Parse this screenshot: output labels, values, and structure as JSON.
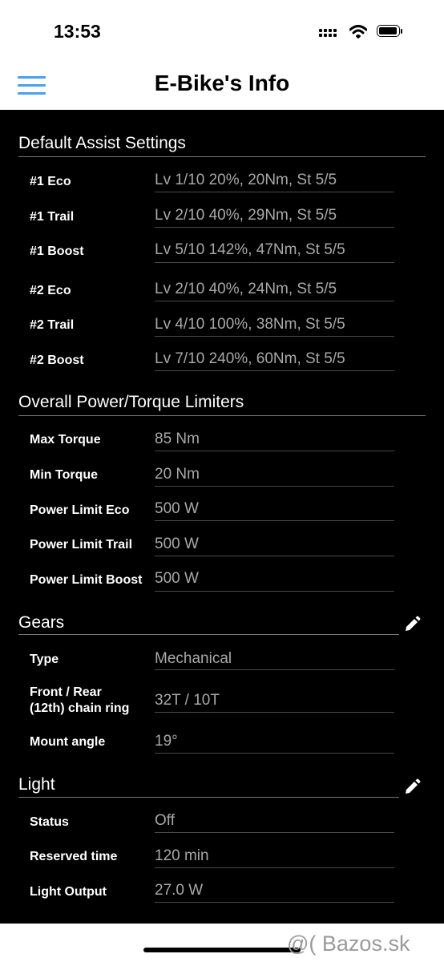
{
  "status_bar": {
    "time": "13:53"
  },
  "nav": {
    "title": "E-Bike's Info"
  },
  "sections": {
    "assist": {
      "title": "Default Assist Settings",
      "rows": [
        {
          "label": "#1 Eco",
          "value": "Lv 1/10 20%, 20Nm, St 5/5"
        },
        {
          "label": "#1 Trail",
          "value": "Lv 2/10 40%, 29Nm, St 5/5"
        },
        {
          "label": "#1 Boost",
          "value": "Lv 5/10 142%, 47Nm, St 5/5"
        },
        {
          "label": "#2 Eco",
          "value": "Lv 2/10 40%, 24Nm, St 5/5"
        },
        {
          "label": "#2 Trail",
          "value": "Lv 4/10 100%, 38Nm, St 5/5"
        },
        {
          "label": "#2 Boost",
          "value": "Lv 7/10 240%, 60Nm, St 5/5"
        }
      ]
    },
    "limiters": {
      "title": "Overall Power/Torque Limiters",
      "rows": [
        {
          "label": "Max Torque",
          "value": "85 Nm"
        },
        {
          "label": "Min Torque",
          "value": "20 Nm"
        },
        {
          "label": "Power Limit Eco",
          "value": "500 W"
        },
        {
          "label": "Power Limit Trail",
          "value": "500 W"
        },
        {
          "label": "Power Limit Boost",
          "value": "500 W"
        }
      ]
    },
    "gears": {
      "title": "Gears",
      "edit_icon": "pencil-icon",
      "rows": [
        {
          "label": "Type",
          "value": "Mechanical"
        },
        {
          "label": "Front / Rear",
          "label2": "(12th) chain ring",
          "value": "32T / 10T"
        },
        {
          "label": "Mount angle",
          "value": "19°"
        }
      ]
    },
    "light": {
      "title": "Light",
      "edit_icon": "pencil-icon",
      "rows": [
        {
          "label": "Status",
          "value": "Off"
        },
        {
          "label": "Reserved time",
          "value": "120 min"
        },
        {
          "label": "Light Output",
          "value": "27.0 W"
        }
      ]
    }
  },
  "watermark": {
    "text": "@( Bazos.sk"
  },
  "colors": {
    "accent": "#4a9ff0",
    "background": "#000000",
    "value_text": "#a8a8a8"
  }
}
